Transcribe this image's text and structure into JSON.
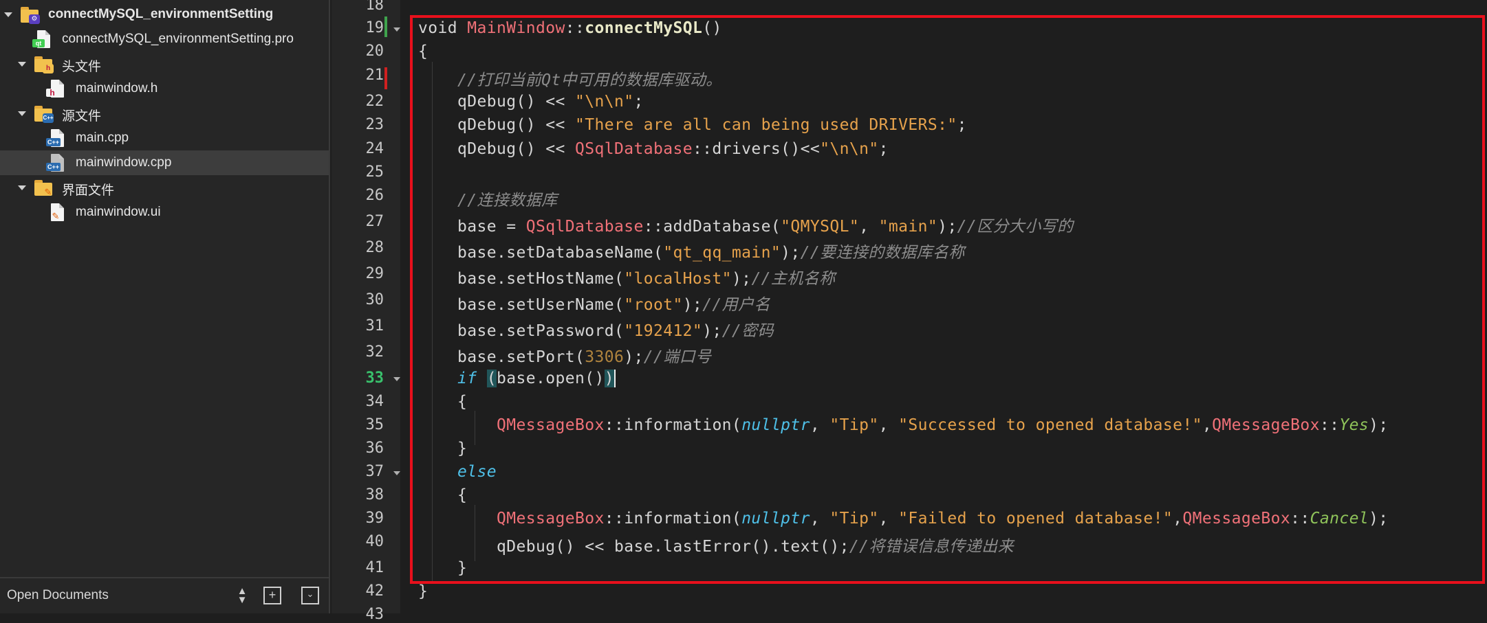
{
  "sidebar": {
    "project_name": "connectMySQL_environmentSetting",
    "pro_file": "connectMySQL_environmentSetting.pro",
    "headers_folder": "头文件",
    "header_file": "mainwindow.h",
    "sources_folder": "源文件",
    "source_main": "main.cpp",
    "source_mainwindow": "mainwindow.cpp",
    "forms_folder": "界面文件",
    "form_file": "mainwindow.ui",
    "open_documents": "Open Documents",
    "badges": {
      "qt": "qt",
      "h": "h",
      "cpp": "C++",
      "cpp_folder": "C++"
    }
  },
  "editor": {
    "line_numbers": [
      "18",
      "19",
      "20",
      "21",
      "22",
      "23",
      "24",
      "25",
      "26",
      "27",
      "28",
      "29",
      "30",
      "31",
      "32",
      "33",
      "34",
      "35",
      "36",
      "37",
      "38",
      "39",
      "40",
      "41",
      "42",
      "43"
    ],
    "current_line": "33",
    "code": {
      "l19": {
        "kw": "void",
        "cls": "MainWindow",
        "sep": "::",
        "fn": "connectMySQL",
        "rest": "()"
      },
      "l20": "{",
      "l21": "//打印当前Qt中可用的数据库驱动。",
      "l22": {
        "a": "qDebug() << ",
        "s": "\"\\n\\n\"",
        "b": ";"
      },
      "l23": {
        "a": "qDebug() << ",
        "s": "\"There are all can being used DRIVERS:\"",
        "b": ";"
      },
      "l24": {
        "a": "qDebug() << ",
        "t": "QSqlDatabase",
        "b": "::drivers()<<",
        "s": "\"\\n\\n\"",
        "c": ";"
      },
      "l26": "//连接数据库",
      "l27": {
        "a": "base = ",
        "t": "QSqlDatabase",
        "b": "::addDatabase(",
        "s1": "\"QMYSQL\"",
        "c": ", ",
        "s2": "\"main\"",
        "d": ");",
        "cm": "//区分大小写的"
      },
      "l28": {
        "a": "base.setDatabaseName(",
        "s": "\"qt_qq_main\"",
        "b": ");",
        "cm": "//要连接的数据库名称"
      },
      "l29": {
        "a": "base.setHostName(",
        "s": "\"localHost\"",
        "b": ");",
        "cm": "//主机名称"
      },
      "l30": {
        "a": "base.setUserName(",
        "s": "\"root\"",
        "b": ");",
        "cm": "//用户名"
      },
      "l31": {
        "a": "base.setPassword(",
        "s": "\"192412\"",
        "b": ");",
        "cm": "//密码"
      },
      "l32": {
        "a": "base.setPort(",
        "n": "3306",
        "b": ");",
        "cm": "//端口号"
      },
      "l33": {
        "kw": "if",
        "sp": " ",
        "p1": "(",
        "mid": "base.open()",
        "p2": ")"
      },
      "l34": "{",
      "l35": {
        "t": "QMessageBox",
        "a": "::information(",
        "it": "nullptr",
        "b": ", ",
        "s1": "\"Tip\"",
        "c": ", ",
        "s2": "\"Successed to opened database!\"",
        "d": ",",
        "t2": "QMessageBox",
        "e": "::",
        "en": "Yes",
        "f": ");"
      },
      "l36": "}",
      "l37": "else",
      "l38": "{",
      "l39": {
        "t": "QMessageBox",
        "a": "::information(",
        "it": "nullptr",
        "b": ", ",
        "s1": "\"Tip\"",
        "c": ", ",
        "s2": "\"Failed to opened database!\"",
        "d": ",",
        "t2": "QMessageBox",
        "e": "::",
        "en": "Cancel",
        "f": ");"
      },
      "l40": {
        "a": "qDebug() << base.lastError().text();",
        "cm": "//将错误信息传递出来"
      },
      "l41": "}",
      "l42": "}"
    },
    "colors": {
      "highlight_box": "#e8101c",
      "current_line_number": "#39c16c"
    }
  }
}
